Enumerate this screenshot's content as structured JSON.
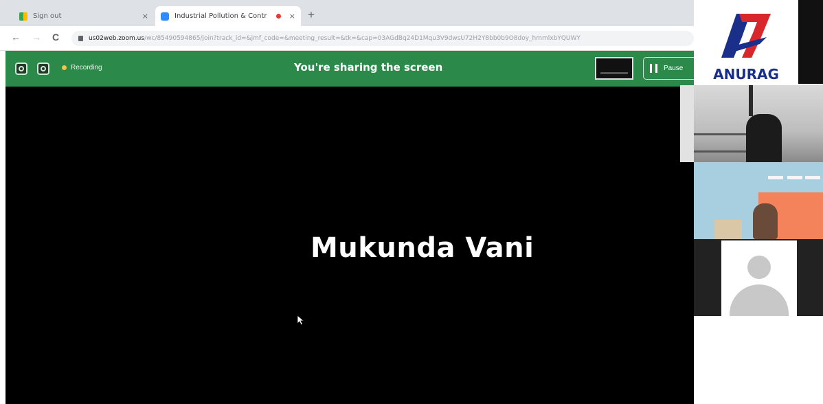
{
  "browser": {
    "tabs": [
      {
        "label": "Sign out",
        "favicon": "sheets-icon",
        "close": "×"
      },
      {
        "label": "Industrial Pollution & Contr",
        "favicon": "zoom-icon",
        "close": "×",
        "recording_dot": true
      }
    ],
    "new_tab_label": "+",
    "back_glyph": "←",
    "forward_glyph": "→",
    "reload_glyph": "C",
    "url_host": "us02web.zoom.us",
    "url_path": "/wc/85490594865/join?track_id=&jmf_code=&meeting_result=&tk=&cap=03AGdBq24D1Mqu3V9dwsU72H2Y8bb0b9O8doy_hmmlxbYQUWY"
  },
  "sharebar": {
    "recording_label": "Recording",
    "title": "You're sharing the screen",
    "pause_label": "Pause",
    "accent_color": "#2b8a4a"
  },
  "shared_screen": {
    "speaker_name": "Mukunda Vani"
  },
  "logo": {
    "text": "ANURAG",
    "colors": {
      "red": "#d7262c",
      "blue": "#1a2f8a"
    }
  },
  "participants": [
    {
      "kind": "video",
      "icon": "camera-feed"
    },
    {
      "kind": "video",
      "icon": "camera-feed"
    },
    {
      "kind": "avatar",
      "icon": "default-avatar-icon"
    }
  ]
}
